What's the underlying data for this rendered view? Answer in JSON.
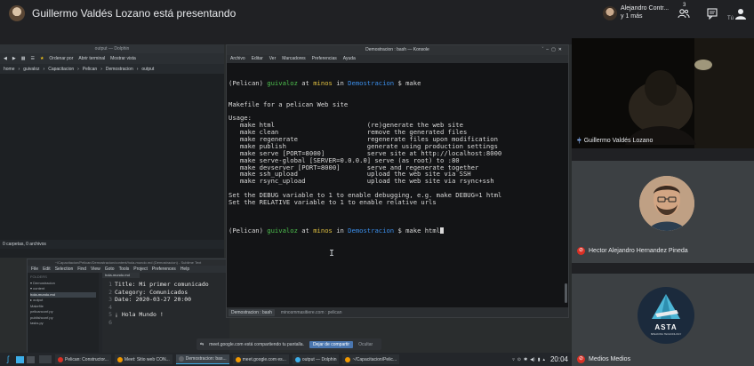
{
  "meet": {
    "presenting_text": "Guillermo Valdés Lozano está presentando",
    "participant_summary_line1": "Alejandro Contr...",
    "participant_summary_line2": "y 1 más",
    "people_badge": "3",
    "user_initial": "Tú"
  },
  "dolphin": {
    "title": "output — Dolphin",
    "toolbar": [
      "Ordenar por",
      "Abrir terminal",
      "Mostrar vista"
    ],
    "crumbs": [
      "home",
      "guivaloz",
      "Capacitacion",
      "Pelican",
      "Demostracion",
      "output"
    ],
    "status": "0 carpetas, 0 archivos"
  },
  "sublime": {
    "title": "~/Capacitacion/Pelican/Demostracion/content/hola-mundo.md (Demostracion) - Sublime Text",
    "menu": [
      "File",
      "Edit",
      "Selection",
      "Find",
      "View",
      "Goto",
      "Tools",
      "Project",
      "Preferences",
      "Help"
    ],
    "sidebar": [
      {
        "text": "FOLDERS",
        "kind": "head"
      },
      {
        "text": "▾ Demostracion",
        "kind": "row"
      },
      {
        "text": "  ▾ content",
        "kind": "row"
      },
      {
        "text": "      hola-mundo.md",
        "kind": "sel"
      },
      {
        "text": "  ▸ output",
        "kind": "row"
      },
      {
        "text": "    Makefile",
        "kind": "row"
      },
      {
        "text": "    pelicanconf.py",
        "kind": "row"
      },
      {
        "text": "    publishconf.py",
        "kind": "row"
      },
      {
        "text": "    tasks.py",
        "kind": "row"
      }
    ],
    "tab": "hola-mundo.md",
    "code": [
      {
        "n": "1",
        "text": "Title: Mi primer comunicado"
      },
      {
        "n": "2",
        "text": "Category: Comunicados"
      },
      {
        "n": "3",
        "text": "Date: 2020-03-27 20:00"
      },
      {
        "n": "4",
        "text": ""
      },
      {
        "n": "5",
        "text": "¡ Hola Mundo !"
      },
      {
        "n": "6",
        "text": ""
      }
    ]
  },
  "konsole": {
    "title": "Demostracion : bash — Konsole",
    "menu": [
      "Archivo",
      "Editar",
      "Ver",
      "Marcadores",
      "Preferencias",
      "Ayuda"
    ],
    "prompt": {
      "env": "(Pelican)",
      "user": "guivaloz",
      "at": "at",
      "host": "minos",
      "in": "in",
      "dir": "Demostracion",
      "sign": "$"
    },
    "cmd1": "make",
    "output": [
      "Makefile for a pelican Web site",
      "",
      "Usage:",
      "   make html                        (re)generate the web site",
      "   make clean                       remove the generated files",
      "   make regenerate                  regenerate files upon modification",
      "   make publish                     generate using production settings",
      "   make serve [PORT=8000]           serve site at http://localhost:8000",
      "   make serve-global [SERVER=0.0.0.0] serve (as root) to :80",
      "   make devserver [PORT=8000]       serve and regenerate together",
      "   make ssh_upload                  upload the web site via SSH",
      "   make rsync_upload                upload the web site via rsync+ssh",
      "",
      "Set the DEBUG variable to 1 to enable debugging, e.g. make DEBUG=1 html",
      "Set the RELATIVE variable to 1 to enable relative urls",
      ""
    ],
    "cmd2": "make html",
    "tabs": [
      "Demostracion : bash",
      "minosmmasitiere.com : pelican"
    ]
  },
  "sharebar": {
    "message": "meet.google.com está compartiendo tu pantalla.",
    "stop_label": "Dejar de compartir",
    "hide_label": "Ocultar"
  },
  "taskbar": {
    "tasks": [
      {
        "label": "Pelican: Constructor...",
        "color": "#d93025",
        "active": false
      },
      {
        "label": "Meet: Sitio web CON...",
        "color": "#f29900",
        "active": false
      },
      {
        "label": "Demostracion: bas...",
        "color": "#5f6368",
        "active": true
      },
      {
        "label": "meet.google.com es...",
        "color": "#f29900",
        "active": false
      },
      {
        "label": "output — Dolphin",
        "color": "#3daee9",
        "active": false
      },
      {
        "label": "~/Capacitacion/Pelic...",
        "color": "#f29900",
        "active": false
      }
    ],
    "clock": "20:04"
  },
  "tiles": {
    "tile1_name": "Guillermo Valdés Lozano",
    "tile2_name": "Hector Alejandro Hernandez Pineda",
    "tile3_name": "Medios Medios",
    "asta_text": "ASTA",
    "asta_sub": "SPEAKING TECHNOLOGY"
  }
}
